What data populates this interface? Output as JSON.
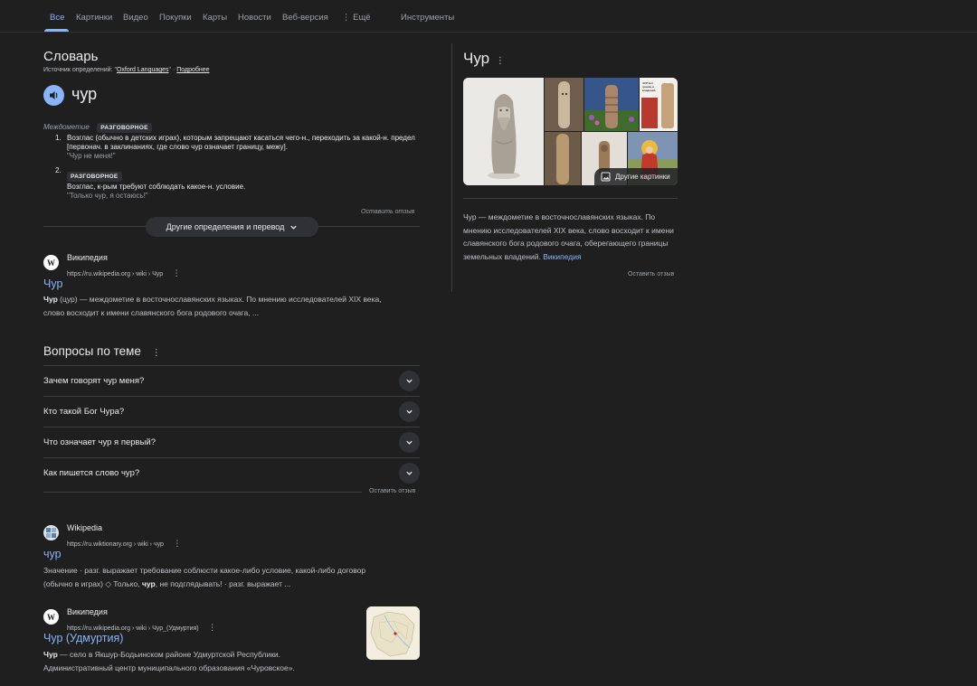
{
  "nav": {
    "tabs": [
      "Все",
      "Картинки",
      "Видео",
      "Покупки",
      "Карты",
      "Новости",
      "Веб-версия"
    ],
    "more": "Ещё",
    "tools": "Инструменты"
  },
  "dictionary": {
    "title": "Словарь",
    "source_prefix": "Источник определений: \"",
    "source_name": "Oxford Languages",
    "source_suffix": "\" ·",
    "more_link": "Подробнее",
    "word": "чур",
    "pos": "Междометие",
    "register": "РАЗГОВОРНОЕ",
    "definitions": [
      {
        "num": "1.",
        "text": "Возглас (обычно в детских играх), которым запрещают касаться чего-н., переходить за какой-н. предел [первонач. в заклинаниях, где слово чур означает границу, межу].",
        "example": "\"Чур не меня!\""
      },
      {
        "num": "2.",
        "badge": "РАЗГОВОРНОЕ",
        "text": "Возглас, к-рым требуют соблюдать какое-н. условие.",
        "example": "\"Только чур, я остаюсь!\""
      }
    ],
    "feedback": "Оставить отзыв",
    "more_button": "Другие определения и перевод"
  },
  "result1": {
    "site": "Википедия",
    "url": "https://ru.wikipedia.org › wiki › Чур",
    "title": "Чур",
    "snippet_bold": "Чур",
    "snippet": " (цур) — междометие в восточнославянских языках. По мнению исследователей XIX века, слово восходит к имени славянского бога родового очага, ..."
  },
  "paa": {
    "title": "Вопросы по теме",
    "questions": [
      "Зачем говорят чур меня?",
      "Кто такой Бог Чура?",
      "Что означает чур я первый?",
      "Как пишется слово чур?"
    ],
    "feedback": "Оставить отзыв"
  },
  "result2": {
    "site": "Wikipedia",
    "url": "https://ru.wiktionary.org › wiki › чур",
    "title": "чур",
    "snippet_a": "Значение · разг. выражает требование соблюсти какое-либо условие, какой-либо договор (обычно в играх) ◇ Только, ",
    "snippet_bold": "чур",
    "snippet_b": ", не подглядывать! · разг. выражает ..."
  },
  "result3": {
    "site": "Википедия",
    "url": "https://ru.wikipedia.org › wiki › Чур_(Удмуртия)",
    "title": "Чур (Удмуртия)",
    "snippet_bold": "Чур",
    "snippet": " — село в Якшур-Бодьинском районе Удмуртской Республики. Административный центр муниципального образования «Чуровское»."
  },
  "knowledge_panel": {
    "title": "Чур",
    "more_images": "Другие картинки",
    "description": "Чур — междометие в восточнославянских языках. По мнению исследователей XIX века, слово восходит к имени славянского бога родового очага, оберегающего границы земельных владений.",
    "source_link": "Википедия",
    "feedback": "Оставить отзыв",
    "book_caption": "ЧУР Бог границ и владений"
  },
  "colors": {
    "background": "#1f1f1f",
    "link": "#8ab4f8",
    "text": "#e8eaed",
    "secondary": "#bdc1c6"
  }
}
